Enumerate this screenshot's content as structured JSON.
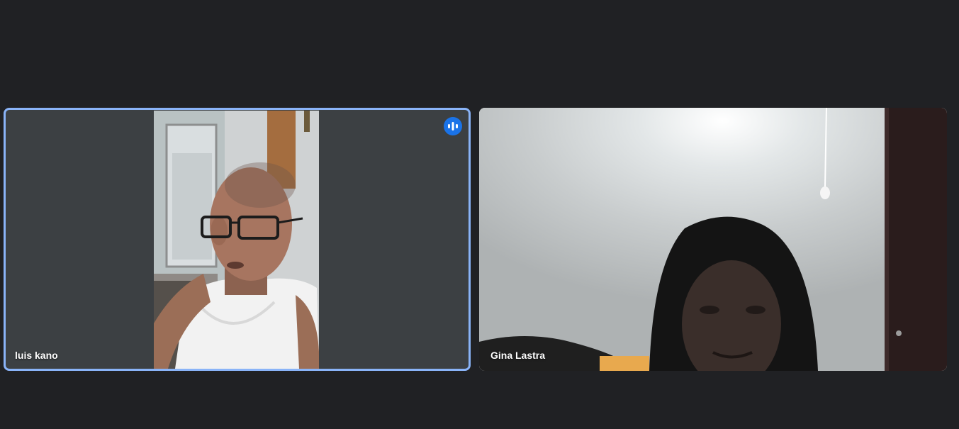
{
  "meeting": {
    "participants": [
      {
        "name": "luis kano",
        "speaking": true,
        "active_speaker_color": "#8ab4f8"
      },
      {
        "name": "Gina Lastra",
        "speaking": false
      }
    ],
    "speaking_indicator_icon": "audio-level-icon",
    "colors": {
      "background": "#202124",
      "tile_background": "#3c4043",
      "accent": "#1a73e8"
    }
  }
}
